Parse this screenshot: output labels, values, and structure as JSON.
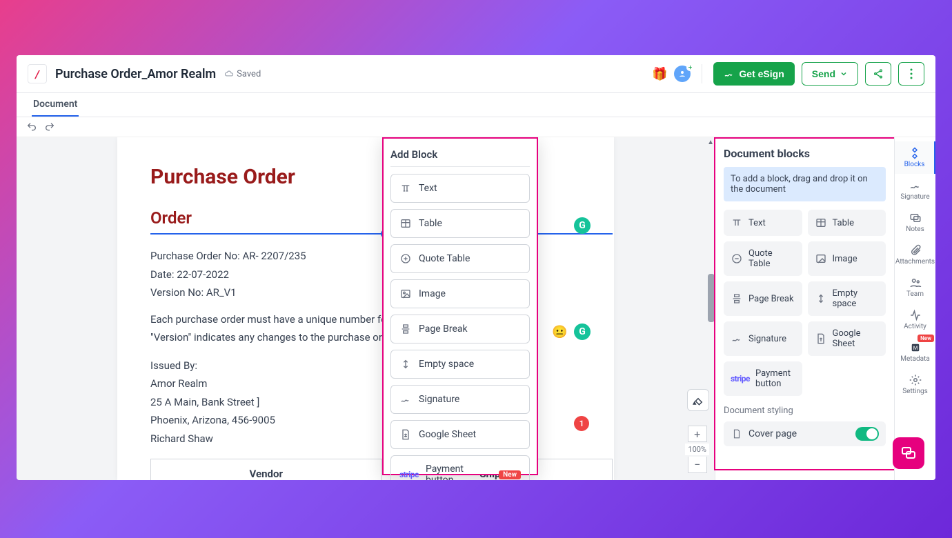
{
  "header": {
    "title": "Purchase Order_Amor Realm",
    "saved": "Saved",
    "esign": "Get eSign",
    "send": "Send"
  },
  "tab": {
    "document": "Document"
  },
  "doc": {
    "h1": "Purchase Order",
    "h2": "Order",
    "po_no": "Purchase Order No: AR- 2207/235",
    "date": "Date: 22-07-2022",
    "version": "Version No: AR_V1",
    "para1": "Each purchase order must have a unique number for refe",
    "para2": "\"Version\" indicates any changes to the purchase order.",
    "issued_by": "Issued By:",
    "issuer_name": "Amor Realm",
    "issuer_addr1": "25 A Main, Bank Street  ]",
    "issuer_addr2": "Phoenix, Arizona, 456-9005",
    "issuer_contact": "Richard Shaw",
    "tbl_vendor": "Vendor",
    "tbl_shipto": "Ship To"
  },
  "popup": {
    "title": "Add Block",
    "items": [
      "Text",
      "Table",
      "Quote Table",
      "Image",
      "Page Break",
      "Empty space",
      "Signature",
      "Google Sheet",
      "Payment button"
    ],
    "new": "New"
  },
  "panel": {
    "title": "Document blocks",
    "hint": "To add a block, drag and drop it on the document",
    "blocks": [
      "Text",
      "Table",
      "Quote Table",
      "Image",
      "Page Break",
      "Empty space",
      "Signature",
      "Google Sheet",
      "Payment button"
    ],
    "styling": "Document styling",
    "cover": "Cover page"
  },
  "rail": {
    "items": [
      "Blocks",
      "Signature",
      "Notes",
      "Attachments",
      "Team",
      "Activity",
      "Metadata",
      "Settings"
    ],
    "new": "New"
  },
  "zoom": {
    "level": "100%"
  },
  "red_badge": "1"
}
